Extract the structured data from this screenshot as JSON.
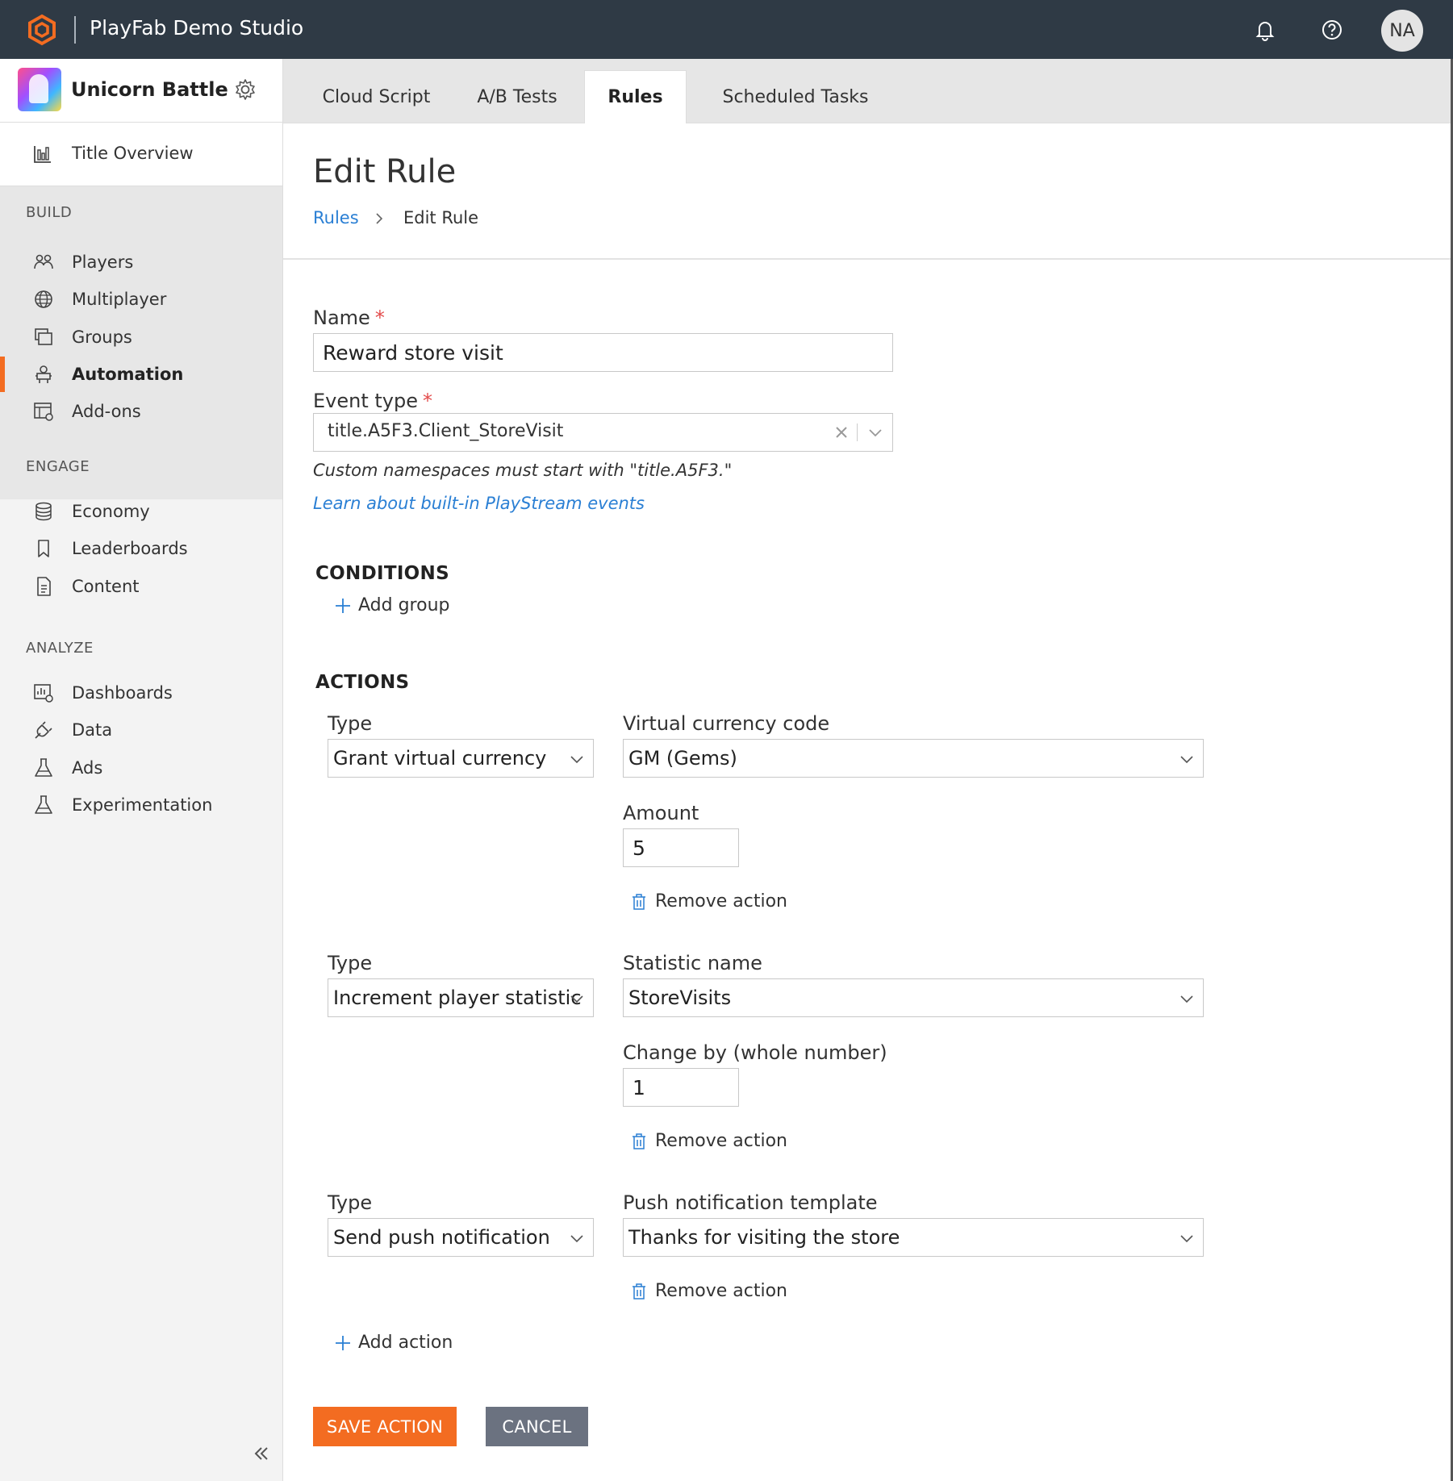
{
  "topbar": {
    "studio_name": "PlayFab Demo Studio",
    "avatar_initials": "NA",
    "brand_color": "#f36c21"
  },
  "sidebar": {
    "title": {
      "name": "Unicorn Battle"
    },
    "overview_label": "Title Overview",
    "sections": {
      "build": "BUILD",
      "engage": "ENGAGE",
      "analyze": "ANALYZE"
    },
    "build_items": [
      {
        "label": "Players",
        "icon": "players-icon"
      },
      {
        "label": "Multiplayer",
        "icon": "globe-icon"
      },
      {
        "label": "Groups",
        "icon": "groups-icon"
      },
      {
        "label": "Automation",
        "icon": "robot-icon",
        "active": true
      },
      {
        "label": "Add-ons",
        "icon": "addons-icon"
      }
    ],
    "engage_items": [
      {
        "label": "Economy",
        "icon": "coins-icon"
      },
      {
        "label": "Leaderboards",
        "icon": "bookmark-icon"
      },
      {
        "label": "Content",
        "icon": "document-icon"
      }
    ],
    "analyze_items": [
      {
        "label": "Dashboards",
        "icon": "dashboard-icon"
      },
      {
        "label": "Data",
        "icon": "plug-icon"
      },
      {
        "label": "Ads",
        "icon": "flask-icon"
      },
      {
        "label": "Experimentation",
        "icon": "flask-icon"
      }
    ]
  },
  "tabs": [
    {
      "label": "Cloud Script"
    },
    {
      "label": "A/B Tests"
    },
    {
      "label": "Rules",
      "active": true
    },
    {
      "label": "Scheduled Tasks"
    }
  ],
  "page": {
    "title": "Edit Rule",
    "breadcrumb": {
      "link": "Rules",
      "separator": ">",
      "current": "Edit Rule"
    }
  },
  "form": {
    "name_label": "Name",
    "required_mark": "*",
    "name_value": "Reward store visit",
    "event_type_label": "Event type",
    "event_type_value": "title.A5F3.Client_StoreVisit",
    "namespace_hint": "Custom namespaces must start with \"title.A5F3.\"",
    "learn_link": "Learn about built-in PlayStream events"
  },
  "conditions": {
    "title": "CONDITIONS",
    "add_group": "Add group"
  },
  "actions": {
    "title": "ACTIONS",
    "type_label": "Type",
    "remove_label": "Remove action",
    "add_action": "Add action",
    "items": [
      {
        "type": "Grant virtual currency",
        "field_label": "Virtual currency code",
        "field_value": "GM (Gems)",
        "extra_label": "Amount",
        "extra_value": "5"
      },
      {
        "type": "Increment player statistic",
        "field_label": "Statistic name",
        "field_value": "StoreVisits",
        "extra_label": "Change by (whole number)",
        "extra_value": "1"
      },
      {
        "type": "Send push notification",
        "field_label": "Push notification template",
        "field_value": "Thanks for visiting the store"
      }
    ]
  },
  "buttons": {
    "save": "SAVE ACTION",
    "cancel": "CANCEL"
  }
}
